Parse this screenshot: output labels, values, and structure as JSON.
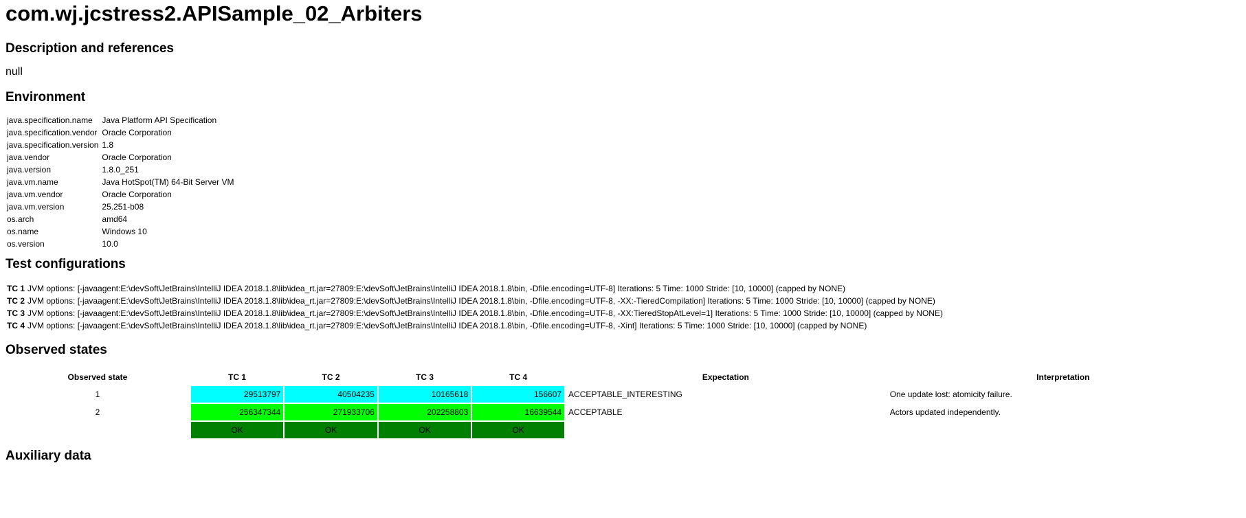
{
  "title": "com.wj.jcstress2.APISample_02_Arbiters",
  "description": {
    "heading": "Description and references",
    "text": "null"
  },
  "environment": {
    "heading": "Environment",
    "rows": [
      {
        "key": "java.specification.name",
        "value": "Java Platform API Specification"
      },
      {
        "key": "java.specification.vendor",
        "value": "Oracle Corporation"
      },
      {
        "key": "java.specification.version",
        "value": "1.8"
      },
      {
        "key": "java.vendor",
        "value": "Oracle Corporation"
      },
      {
        "key": "java.version",
        "value": "1.8.0_251"
      },
      {
        "key": "java.vm.name",
        "value": "Java HotSpot(TM) 64-Bit Server VM"
      },
      {
        "key": "java.vm.vendor",
        "value": "Oracle Corporation"
      },
      {
        "key": "java.vm.version",
        "value": "25.251-b08"
      },
      {
        "key": "os.arch",
        "value": "amd64"
      },
      {
        "key": "os.name",
        "value": "Windows 10"
      },
      {
        "key": "os.version",
        "value": "10.0"
      }
    ]
  },
  "test_configurations": {
    "heading": "Test configurations",
    "rows": [
      {
        "name": "TC 1",
        "text": "JVM options: [-javaagent:E:\\devSoft\\JetBrains\\IntelliJ IDEA 2018.1.8\\lib\\idea_rt.jar=27809:E:\\devSoft\\JetBrains\\IntelliJ IDEA 2018.1.8\\bin, -Dfile.encoding=UTF-8] Iterations: 5 Time: 1000 Stride: [10, 10000] (capped by NONE)"
      },
      {
        "name": "TC 2",
        "text": "JVM options: [-javaagent:E:\\devSoft\\JetBrains\\IntelliJ IDEA 2018.1.8\\lib\\idea_rt.jar=27809:E:\\devSoft\\JetBrains\\IntelliJ IDEA 2018.1.8\\bin, -Dfile.encoding=UTF-8, -XX:-TieredCompilation] Iterations: 5 Time: 1000 Stride: [10, 10000] (capped by NONE)"
      },
      {
        "name": "TC 3",
        "text": "JVM options: [-javaagent:E:\\devSoft\\JetBrains\\IntelliJ IDEA 2018.1.8\\lib\\idea_rt.jar=27809:E:\\devSoft\\JetBrains\\IntelliJ IDEA 2018.1.8\\bin, -Dfile.encoding=UTF-8, -XX:TieredStopAtLevel=1] Iterations: 5 Time: 1000 Stride: [10, 10000] (capped by NONE)"
      },
      {
        "name": "TC 4",
        "text": "JVM options: [-javaagent:E:\\devSoft\\JetBrains\\IntelliJ IDEA 2018.1.8\\lib\\idea_rt.jar=27809:E:\\devSoft\\JetBrains\\IntelliJ IDEA 2018.1.8\\bin, -Dfile.encoding=UTF-8, -Xint] Iterations: 5 Time: 1000 Stride: [10, 10000] (capped by NONE)"
      }
    ]
  },
  "observed_states": {
    "heading": "Observed states",
    "headers": {
      "state": "Observed state",
      "tc1": "TC 1",
      "tc2": "TC 2",
      "tc3": "TC 3",
      "tc4": "TC 4",
      "expectation": "Expectation",
      "interpretation": "Interpretation"
    },
    "rows": [
      {
        "state": "1",
        "tc1": "29513797",
        "tc2": "40504235",
        "tc3": "10165618",
        "tc4": "156607",
        "expectation": "ACCEPTABLE_INTERESTING",
        "interpretation": "One update lost: atomicity failure."
      },
      {
        "state": "2",
        "tc1": "256347344",
        "tc2": "271933706",
        "tc3": "202258803",
        "tc4": "16639544",
        "expectation": "ACCEPTABLE",
        "interpretation": "Actors updated independently."
      }
    ],
    "status": {
      "tc1": "OK",
      "tc2": "OK",
      "tc3": "OK",
      "tc4": "OK"
    }
  },
  "auxiliary": {
    "heading": "Auxiliary data"
  },
  "colors": {
    "interesting": "#00ffff",
    "acceptable": "#00ff00",
    "ok": "#008000"
  }
}
